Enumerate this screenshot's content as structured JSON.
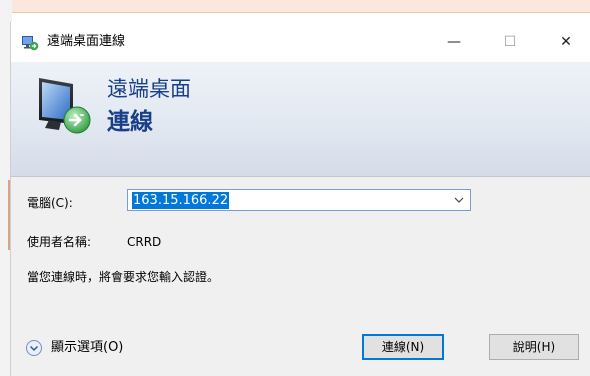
{
  "window": {
    "title": "遠端桌面連線",
    "minimize_glyph": "—",
    "maximize_glyph": "☐",
    "close_glyph": "✕"
  },
  "banner": {
    "line1": "遠端桌面",
    "line2": "連線"
  },
  "form": {
    "computer_label": "電腦(C):",
    "computer_value": "163.15.166.22",
    "username_label": "使用者名稱:",
    "username_value": "CRRD",
    "info_text": "當您連線時，將會要求您輸入認證。"
  },
  "footer": {
    "show_options_label": "顯示選項(O)",
    "connect_label": "連線(N)",
    "help_label": "說明(H)"
  },
  "colors": {
    "banner_text": "#1a3f8a",
    "selection": "#0078d7"
  }
}
